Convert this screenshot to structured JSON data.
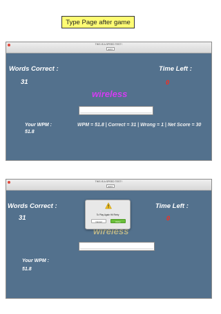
{
  "caption": "Type Page after game",
  "window1": {
    "title": "THIS IS A SPEED TEST !",
    "exit_label": "EXIT",
    "words_correct_label": "Words Correct :",
    "words_correct_value": "31",
    "time_left_label": "Time Left :",
    "time_left_value": "0",
    "current_word": "wireless",
    "input_value": "",
    "wpm_label": "Your WPM :",
    "wpm_value": "51.8",
    "result_text": "WPM = 51.8 | Correct = 31 | Wrong = 1 | Net Score = 30"
  },
  "window2": {
    "title": "THIS IS A SPEED TEST !",
    "exit_label": "EXIT",
    "words_correct_label": "Words Correct :",
    "words_correct_value": "31",
    "time_left_label": "Time Left :",
    "time_left_value": "0",
    "current_word": "wireless",
    "input_value": "",
    "wpm_label": "Your WPM :",
    "wpm_value": "51.8",
    "dialog": {
      "message": "To Play Again Hit Retry",
      "cancel_label": "Cancel",
      "retry_label": "Retry"
    }
  },
  "colors": {
    "window_bg": "#53718d",
    "word": "#d43cf2",
    "time_left": "#ff2a1a",
    "caption_bg": "#fffc74",
    "retry_button": "#6bbf3b"
  }
}
